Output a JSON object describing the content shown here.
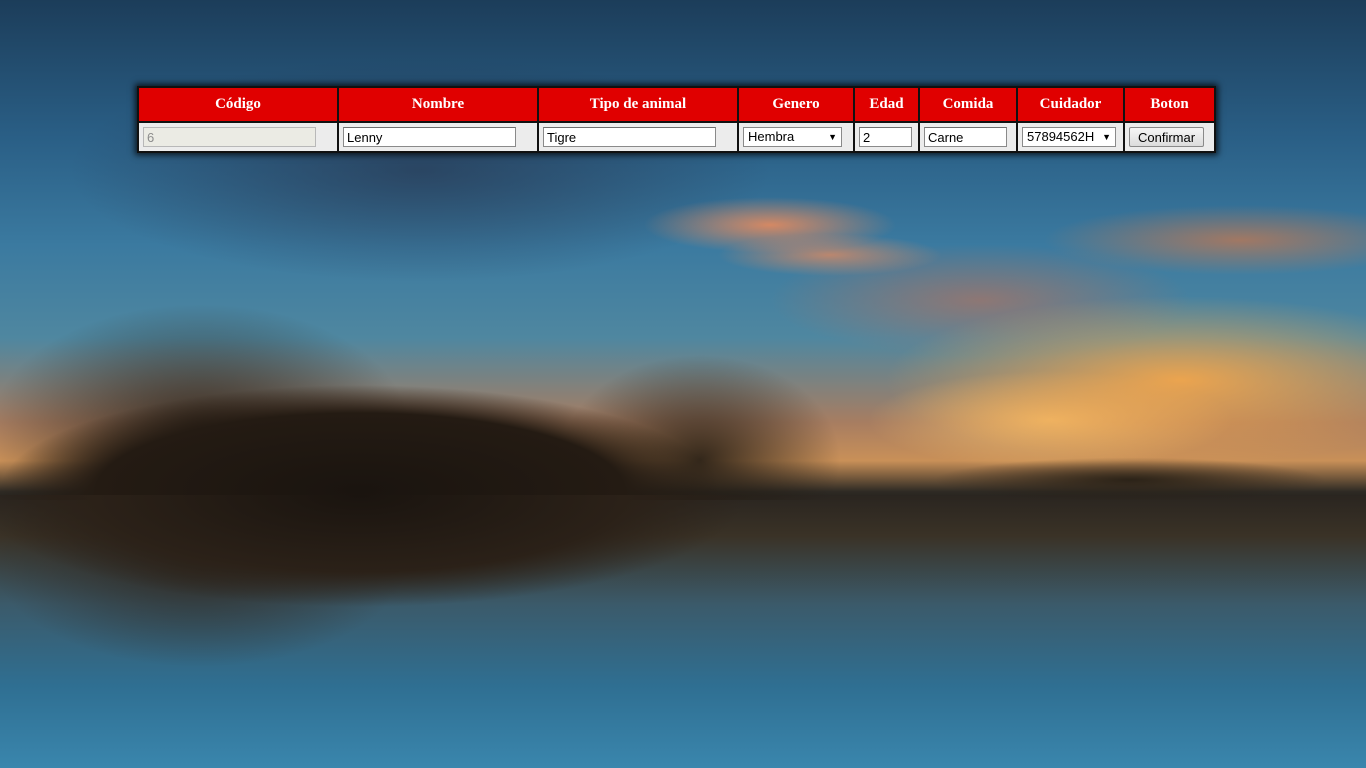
{
  "form": {
    "headers": {
      "codigo": "Código",
      "nombre": "Nombre",
      "tipo": "Tipo de animal",
      "genero": "Genero",
      "edad": "Edad",
      "comida": "Comida",
      "cuidador": "Cuidador",
      "boton": "Boton"
    },
    "fields": {
      "codigo": "6",
      "nombre": "Lenny",
      "tipo": "Tigre",
      "genero": "Hembra",
      "edad": "2",
      "comida": "Carne",
      "cuidador": "57894562H"
    },
    "submit_label": "Confirmar"
  },
  "icons": {
    "dropdown": "chevron-down-icon"
  },
  "colors": {
    "header_bg": "#e00000",
    "header_text": "#ffffff",
    "row_bg": "#ececec"
  }
}
